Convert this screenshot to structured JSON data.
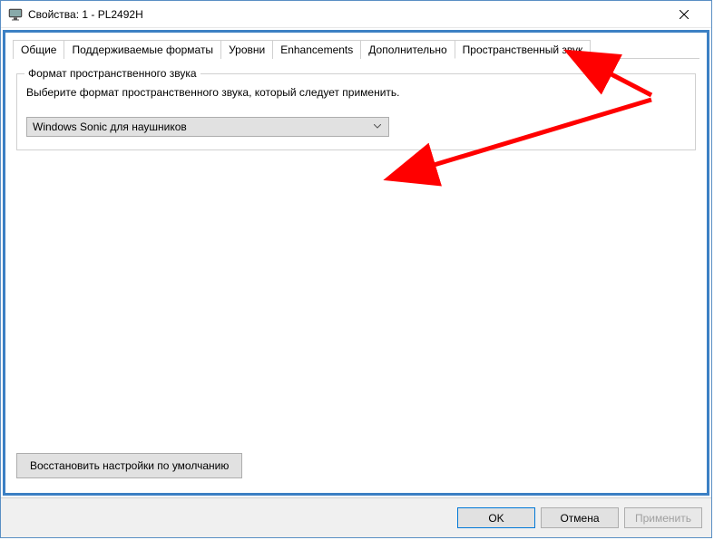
{
  "window": {
    "title": "Свойства: 1 - PL2492H"
  },
  "tabs": [
    {
      "label": "Общие"
    },
    {
      "label": "Поддерживаемые форматы"
    },
    {
      "label": "Уровни"
    },
    {
      "label": "Enhancements"
    },
    {
      "label": "Дополнительно"
    },
    {
      "label": "Пространственный звук"
    }
  ],
  "group": {
    "title": "Формат пространственного звука",
    "description": "Выберите формат пространственного звука, который следует применить.",
    "dropdown_value": "Windows Sonic для наушников"
  },
  "buttons": {
    "restore": "Восстановить настройки по умолчанию",
    "ok": "OK",
    "cancel": "Отмена",
    "apply": "Применить"
  }
}
